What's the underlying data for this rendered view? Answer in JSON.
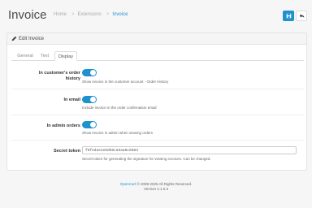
{
  "header": {
    "title": "Invoice",
    "breadcrumb": [
      "Home",
      "Extensions",
      "Invoice"
    ]
  },
  "card": {
    "title": "Edit Invoice",
    "tabs": [
      {
        "label": "General",
        "active": false
      },
      {
        "label": "Text",
        "active": false
      },
      {
        "label": "Display",
        "active": true
      }
    ]
  },
  "settings": {
    "order_history": {
      "label_line1": "In customer's order",
      "label_line2": "history",
      "enabled": true,
      "help": "Show invoice in the customer account - Order History"
    },
    "email": {
      "label": "In email",
      "enabled": true,
      "help": "Include invoice in the order confirmation email"
    },
    "admin_orders": {
      "label": "In admin orders",
      "enabled": true,
      "help": "Show invoice in admin when viewing orders"
    },
    "secret_token": {
      "label": "Secret token",
      "value": "f8fedae1e9d69ca6aa0c698d",
      "help": "Secret token for generating the signature for viewing invoices. Can be changed."
    }
  },
  "footer": {
    "link_text": "OpenCart",
    "copyright": " © 2009-2025 All Rights Reserved.",
    "version": "Version 4.1.0.3"
  },
  "colors": {
    "accent": "#1e91cf",
    "background": "#f6f6f6"
  }
}
